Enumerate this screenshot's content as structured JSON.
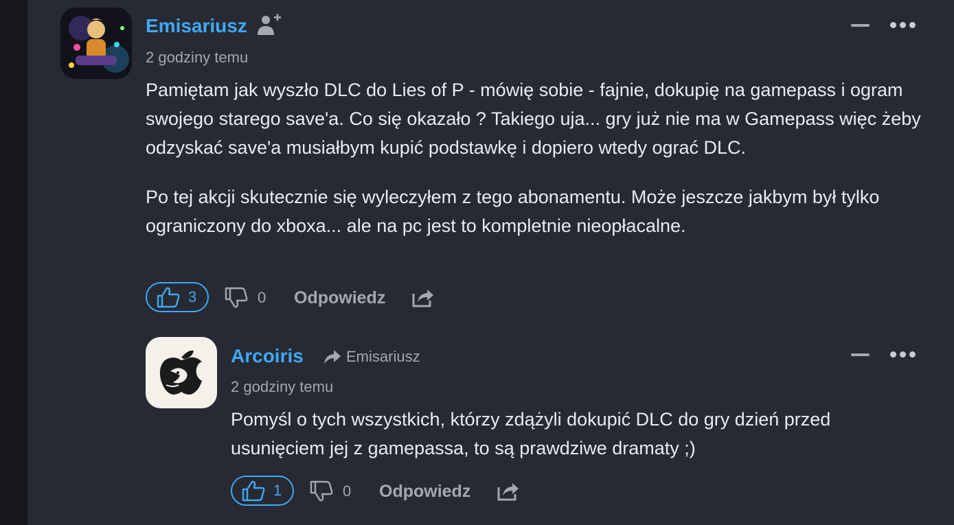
{
  "comments": [
    {
      "username": "Emisariusz",
      "timestamp": "2 godziny temu",
      "paragraphs": [
        "Pamiętam jak wyszło DLC do Lies of P - mówię sobie - fajnie, dokupię na gamepass i ogram swojego starego save'a. Co się okazało ? Takiego uja... gry już nie ma w Gamepass więc żeby odzyskać save'a musiałbym kupić podstawkę i dopiero wtedy ograć DLC.",
        "Po tej akcji skutecznie się wyleczyłem z tego abonamentu. Może jeszcze jakbym był tylko ograniczony do xboxa... ale na pc jest to kompletnie nieopłacalne."
      ],
      "likes": "3",
      "dislikes": "0",
      "reply_label": "Odpowiedz",
      "avatar_icon": "robot-gamer-avatar",
      "follow_icon": "add-user-icon"
    },
    {
      "username": "Arcoiris",
      "reply_to": "Emisariusz",
      "timestamp": "2 godziny temu",
      "paragraphs": [
        "Pomyśl o tych wszystkich, którzy zdążyli dokupić DLC do gry dzień przed usunięciem jej z gamepassa, to są prawdziwe dramaty ;)"
      ],
      "likes": "1",
      "dislikes": "0",
      "reply_label": "Odpowiedz",
      "avatar_icon": "dragon-apple-avatar"
    }
  ],
  "colors": {
    "background": "#272a33",
    "accent": "#3fa9f5",
    "text": "#e9ebf0",
    "muted": "#a3a8b3",
    "sidebar": "#17181c"
  }
}
